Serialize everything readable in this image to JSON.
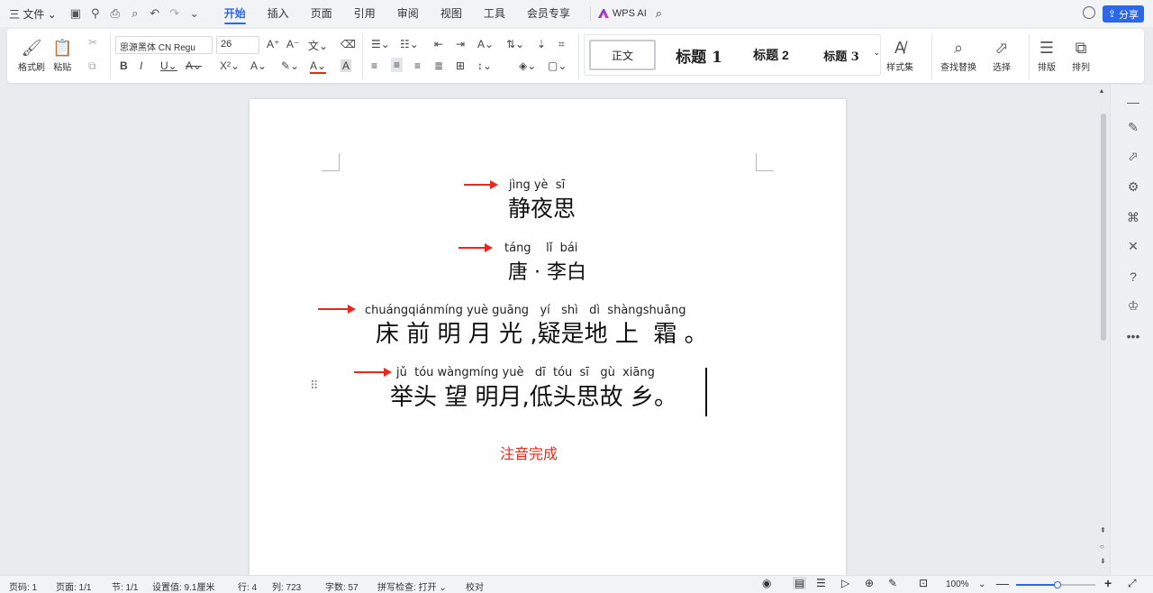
{
  "menubar": {
    "file_label": "三 文件 ⌄",
    "tabs": [
      "开始",
      "插入",
      "页面",
      "引用",
      "审阅",
      "视图",
      "工具",
      "会员专享"
    ],
    "ai_label": "WPS AI",
    "share_label": "分享"
  },
  "ribbon": {
    "format_painter": "格式刷",
    "paste": "粘贴",
    "font_name": "思源黑体 CN Regu",
    "font_size": "26",
    "styles": {
      "normal": "正文",
      "h1": "标题 1",
      "h2": "标题 2",
      "h3": "标题 3"
    },
    "style_set": "样式集",
    "find_replace": "查找替换",
    "select": "选择",
    "layout": "排版",
    "arrange": "排列"
  },
  "document": {
    "title_pinyin": "jìng yè  sī",
    "title": "静夜思",
    "author_pinyin": "táng    lǐ  bái",
    "author": "唐 · 李白",
    "line1_pinyin": "chuángqiánmíng yuè guāng   yí   shì   dì  shàngshuāng",
    "line1": "床 前 明 月 光 ,疑是地 上  霜 。",
    "line2_pinyin": "jǔ  tóu wàngmíng yuè   dī  tóu  sī   gù  xiāng",
    "line2": "举头 望 明月,低头思故 乡。",
    "status_note": "注音完成",
    "accent_color": "#e8281c"
  },
  "statusbar": {
    "page_no": "页码: 1",
    "pages": "页面: 1/1",
    "section": "节: 1/1",
    "setting": "设置值: 9.1厘米",
    "row": "行: 4",
    "col": "列: 723",
    "word_count": "字数: 57",
    "spell_check": "拼写检查: 打开 ⌄",
    "proofread": "校对",
    "zoom": "100%"
  }
}
